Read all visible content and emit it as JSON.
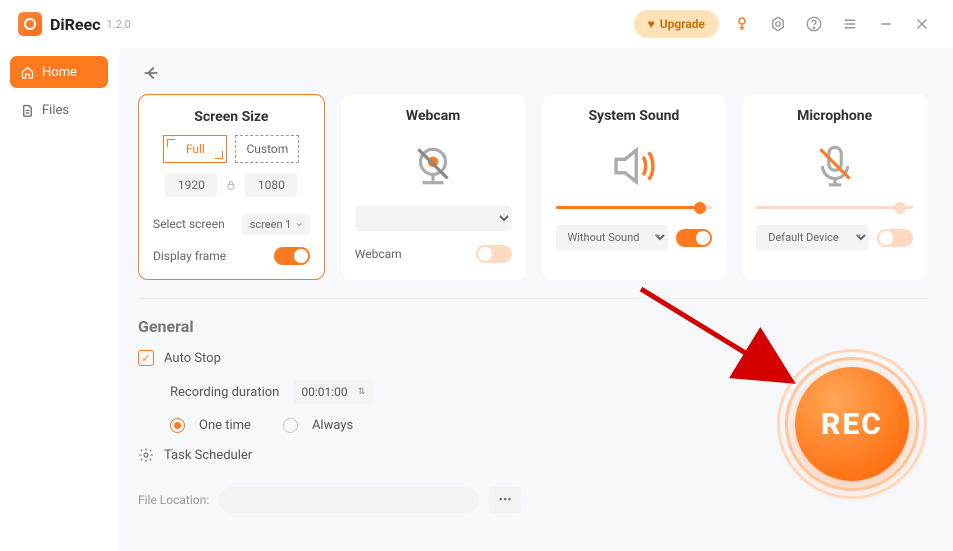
{
  "app": {
    "name": "DiReec",
    "version": "1.2.0"
  },
  "titlebar": {
    "upgrade": "Upgrade"
  },
  "nav": {
    "home": "Home",
    "files": "Files"
  },
  "cards": {
    "screen": {
      "title": "Screen Size",
      "full": "Full",
      "custom": "Custom",
      "w": "1920",
      "h": "1080",
      "select_label": "Select screen",
      "screen_value": "screen 1",
      "display_frame": "Display frame"
    },
    "webcam": {
      "title": "Webcam",
      "label": "Webcam"
    },
    "sound": {
      "title": "System Sound",
      "value": "Without Sound"
    },
    "mic": {
      "title": "Microphone",
      "value": "Default Device"
    }
  },
  "general": {
    "title": "General",
    "auto_stop": "Auto Stop",
    "rec_duration_label": "Recording duration",
    "rec_duration_value": "00:01:00",
    "one_time": "One time",
    "always": "Always",
    "task_scheduler": "Task Scheduler",
    "file_location": "File Location:"
  },
  "rec": {
    "label": "REC"
  }
}
